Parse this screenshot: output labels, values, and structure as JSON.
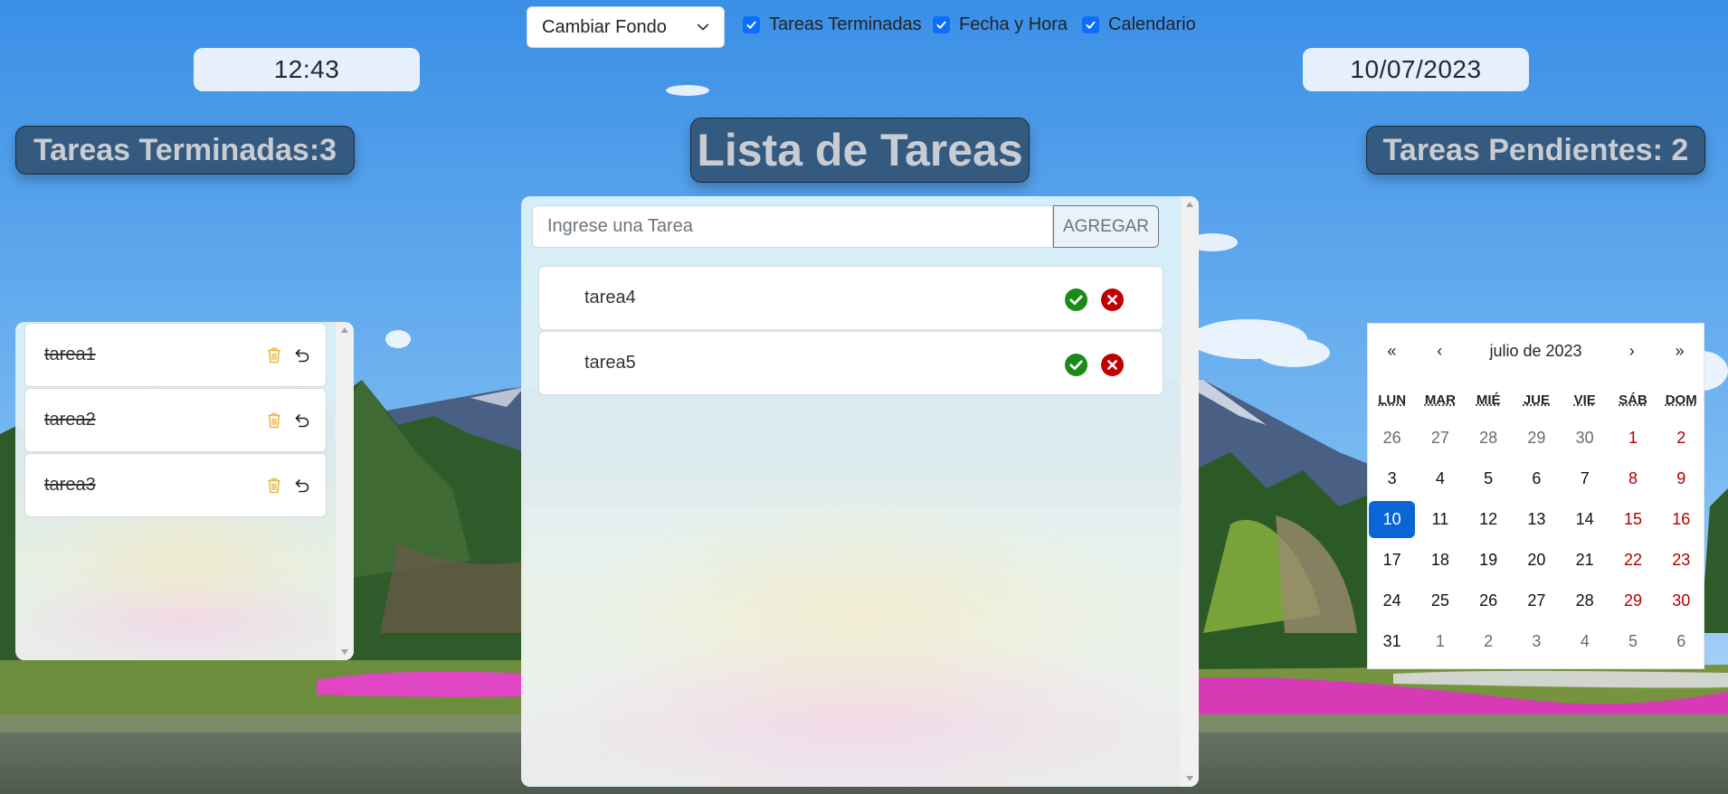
{
  "toolbar": {
    "background_select": "Cambiar Fondo",
    "toggles": [
      {
        "label": "Tareas Terminadas",
        "checked": true
      },
      {
        "label": "Fecha y Hora",
        "checked": true
      },
      {
        "label": "Calendario",
        "checked": true
      }
    ]
  },
  "clock": {
    "time": "12:43",
    "date": "10/07/2023"
  },
  "headers": {
    "done_count": "Tareas Terminadas:3",
    "title": "Lista de Tareas",
    "pending_count": "Tareas Pendientes: 2"
  },
  "form": {
    "placeholder": "Ingrese una Tarea",
    "add_label": "AGREGAR"
  },
  "pending_tasks": [
    "tarea4",
    "tarea5"
  ],
  "done_tasks": [
    "tarea1",
    "tarea2",
    "tarea3"
  ],
  "calendar": {
    "prev_year": "«",
    "prev_month": "‹",
    "month_label": "julio de 2023",
    "next_month": "›",
    "next_year": "»",
    "weekdays": [
      "LUN",
      "MAR",
      "MIÉ",
      "JUE",
      "VIE",
      "SÁB",
      "DOM"
    ],
    "weeks": [
      [
        "26",
        "27",
        "28",
        "29",
        "30",
        "1",
        "2"
      ],
      [
        "3",
        "4",
        "5",
        "6",
        "7",
        "8",
        "9"
      ],
      [
        "10",
        "11",
        "12",
        "13",
        "14",
        "15",
        "16"
      ],
      [
        "17",
        "18",
        "19",
        "20",
        "21",
        "22",
        "23"
      ],
      [
        "24",
        "25",
        "26",
        "27",
        "28",
        "29",
        "30"
      ],
      [
        "31",
        "1",
        "2",
        "3",
        "4",
        "5",
        "6"
      ]
    ],
    "selected_day": "10",
    "accent_color": "#0a66d6",
    "weekend_color": "#b00000"
  },
  "icons": {
    "complete": "check-circle-icon",
    "delete": "x-circle-icon",
    "trash": "trash-icon",
    "undo": "undo-arrow-icon"
  },
  "colors": {
    "header_badge": "#355a80",
    "complete_green": "#1a8a1a",
    "delete_red": "#c00000",
    "trash_yellow": "#e8b84a",
    "checkbox_blue": "#0d6efd"
  }
}
